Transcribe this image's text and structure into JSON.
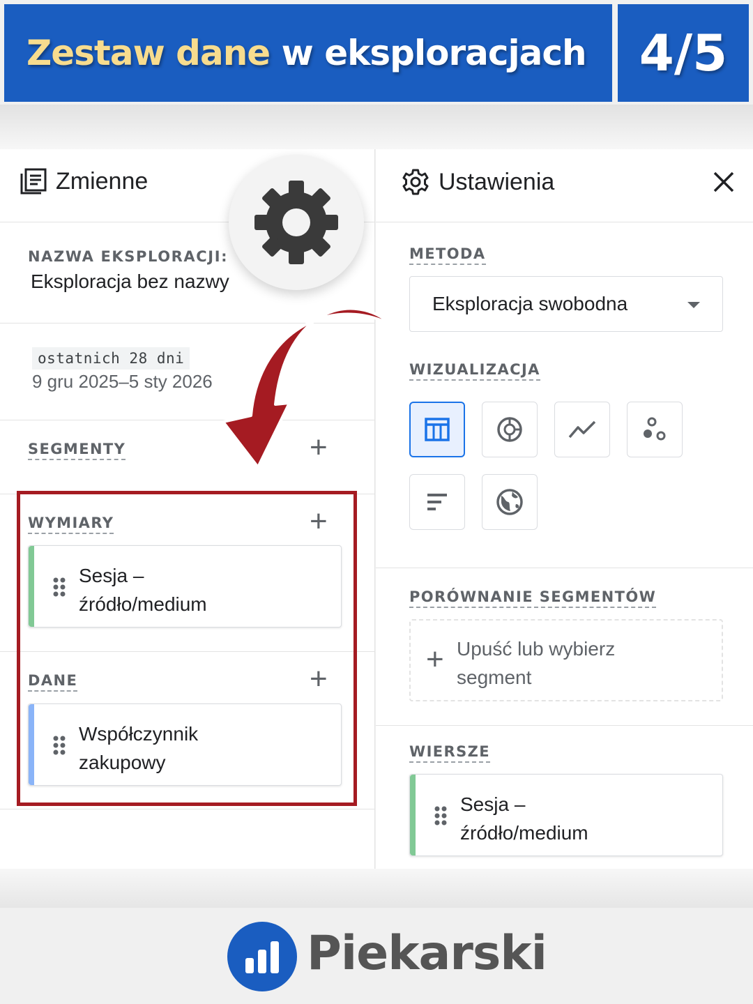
{
  "header": {
    "title_highlight": "Zestaw dane",
    "title_rest": "w eksploracjach",
    "counter": "4/5"
  },
  "left_panel": {
    "title": "Zmienne",
    "exploration_name_label": "NAZWA EKSPLORACJI:",
    "exploration_name_value": "Eksploracja bez nazwy",
    "date_chip": "ostatnich 28 dni",
    "date_range": "9 gru 2025–5 sty 2026",
    "segments_label": "SEGMENTY",
    "dimensions_label": "WYMIARY",
    "dimension_item_line1": "Sesja –",
    "dimension_item_line2": "źródło/medium",
    "metrics_label": "DANE",
    "metric_item_line1": "Współczynnik",
    "metric_item_line2": "zakupowy"
  },
  "right_panel": {
    "title": "Ustawienia",
    "method_label": "METODA",
    "method_value": "Eksploracja swobodna",
    "viz_label": "WIZUALIZACJA",
    "segment_compare_label": "PORÓWNANIE SEGMENTÓW",
    "dropzone_text": "Upuść lub wybierz segment",
    "rows_label": "WIERSZE",
    "row_item_line1": "Sesja –",
    "row_item_line2": "źródło/medium"
  },
  "icons": {
    "variables": "document-list-icon",
    "settings": "gear-icon",
    "close": "close-icon",
    "viz": [
      "table-icon",
      "donut-chart-icon",
      "line-chart-icon",
      "scatter-plot-icon",
      "bar-chart-icon",
      "globe-icon"
    ]
  },
  "colors": {
    "brand_blue": "#1a5dc0",
    "title_highlight": "#f7dc8e",
    "highlight_red": "#a51b22",
    "dimension_green": "#81c995",
    "metric_blue": "#8ab4f8",
    "active_blue": "#1a73e8"
  },
  "footer": {
    "brand": "Piekarski"
  }
}
